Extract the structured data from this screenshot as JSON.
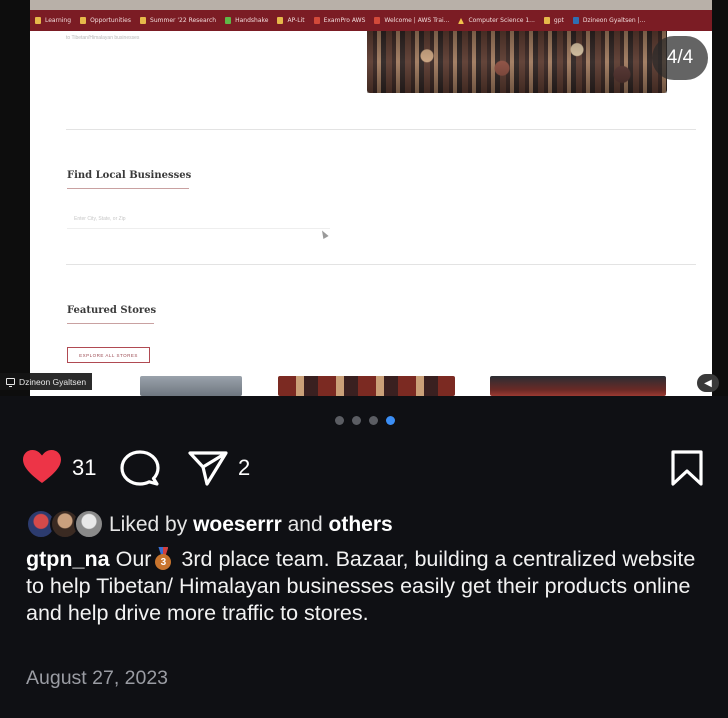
{
  "media": {
    "bookmarks": [
      {
        "label": "Learning",
        "icon": "folder-icon"
      },
      {
        "label": "Opportunities",
        "icon": "folder-icon"
      },
      {
        "label": "Summer '22 Research",
        "icon": "folder-icon"
      },
      {
        "label": "Handshake",
        "icon": "handshake-icon"
      },
      {
        "label": "AP-Lit",
        "icon": "folder-icon"
      },
      {
        "label": "ExamPro AWS",
        "icon": "exampro-icon"
      },
      {
        "label": "Welcome | AWS Trai...",
        "icon": "aws-icon"
      },
      {
        "label": "Computer Science 1...",
        "icon": "drive-icon"
      },
      {
        "label": "gpt",
        "icon": "folder-icon"
      },
      {
        "label": "Dzineon Gyaltsen |...",
        "icon": "linkedin-icon"
      }
    ],
    "blur_text": "to Tibetan/Himalayan businesses",
    "find_local_title": "Find Local Businesses",
    "search_placeholder": "Enter City, State, or Zip",
    "featured_title": "Featured Stores",
    "explore_button": "EXPLORE ALL STORES",
    "presenter_name": "Dzineon Gyaltsen",
    "slide_counter": "4/4"
  },
  "carousel": {
    "total": 4,
    "active_index": 4
  },
  "post": {
    "like_count": "31",
    "share_count": "2",
    "liked_by_prefix": "Liked by",
    "liked_by_user": "woeserrr",
    "liked_by_and": "and",
    "liked_by_others": "others",
    "author": "gtpn_na",
    "caption_before_emoji": "Our",
    "caption_emoji": "3rd place medal",
    "caption_after_emoji": "3rd place team. Bazaar, building a centralized website to help Tibetan/ Himalayan businesses easily get their products online and help drive more traffic to stores.",
    "date": "August 27, 2023"
  },
  "colors": {
    "background": "#0f1014",
    "like_red": "#ed3447",
    "carousel_active": "#3b8ef5",
    "bookmark_bar": "#7b1c24"
  }
}
